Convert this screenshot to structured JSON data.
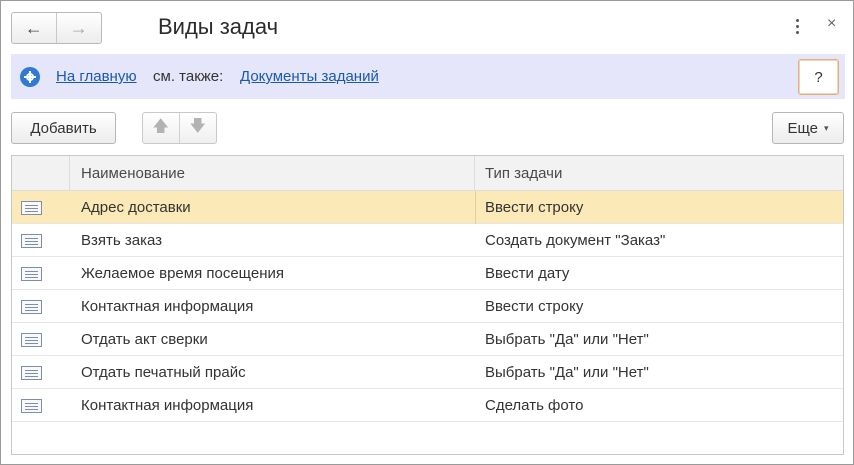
{
  "window": {
    "title": "Виды задач",
    "back_icon": "←",
    "forward_icon": "→",
    "more_icon": "kebab-vertical",
    "close_label": "×"
  },
  "infobar": {
    "home_link": "На главную",
    "see_also": "см. также:",
    "docs_link": "Документы заданий",
    "help_label": "?",
    "accent": "#2f7ad3",
    "background": "#e6e6fa"
  },
  "toolbar": {
    "add_label": "Добавить",
    "up_icon": "🡅",
    "down_icon": "🡇",
    "more_label": "Еще",
    "more_caret": "▾"
  },
  "table": {
    "columns": [
      "Наименование",
      "Тип задачи"
    ],
    "selected_row": 0,
    "selected_color": "#fbeab7",
    "rows": [
      {
        "name": "Адрес доставки",
        "type": "Ввести строку"
      },
      {
        "name": "Взять заказ",
        "type": "Создать документ \"Заказ\""
      },
      {
        "name": "Желаемое время посещения",
        "type": "Ввести дату"
      },
      {
        "name": "Контактная информация",
        "type": "Ввести строку"
      },
      {
        "name": "Отдать акт сверки",
        "type": "Выбрать \"Да\" или \"Нет\""
      },
      {
        "name": "Отдать печатный прайс",
        "type": "Выбрать \"Да\" или \"Нет\""
      },
      {
        "name": "Контактная информация",
        "type": "Сделать фото"
      }
    ]
  }
}
